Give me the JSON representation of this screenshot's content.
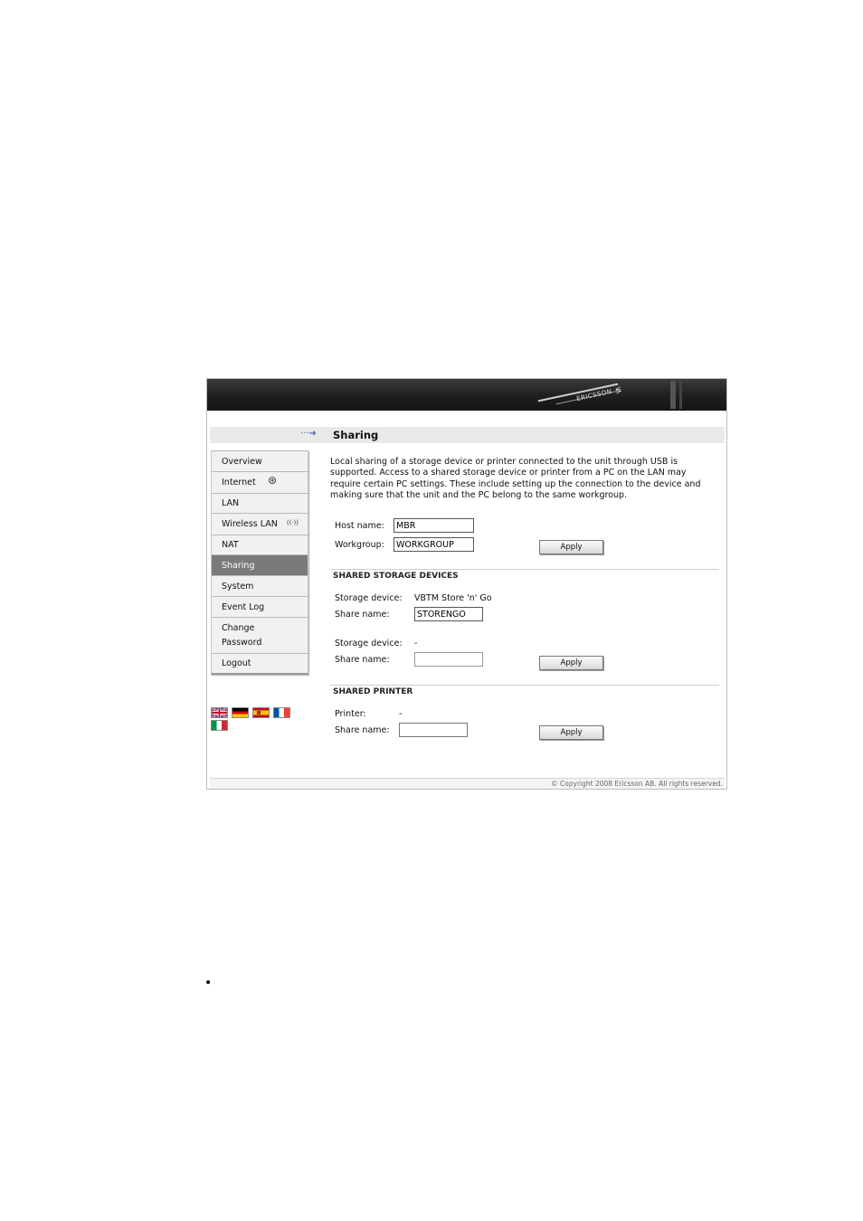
{
  "banner": {
    "logo_text": "ERICSSON",
    "logo_mark": "≶"
  },
  "header": {
    "arrow": "···➜",
    "title": "Sharing"
  },
  "menu": {
    "items": [
      {
        "label": "Overview",
        "icon": ""
      },
      {
        "label": "Internet",
        "icon": "⊛"
      },
      {
        "label": "LAN",
        "icon": ""
      },
      {
        "label": "Wireless LAN",
        "icon": "((·))"
      },
      {
        "label": "NAT",
        "icon": ""
      },
      {
        "label": "Sharing",
        "icon": "",
        "active": true
      },
      {
        "label": "System",
        "icon": ""
      },
      {
        "label": "Event Log",
        "icon": ""
      },
      {
        "label": "Change Password",
        "icon": ""
      },
      {
        "label": "Logout",
        "icon": ""
      }
    ]
  },
  "languages": [
    "english-flag",
    "german-flag",
    "spanish-flag",
    "french-flag",
    "italian-flag"
  ],
  "intro": "Local sharing of a storage device or printer connected to the unit through USB is supported. Access to a shared storage device or printer from a PC on the LAN may require certain PC settings. These include setting up the connection to the device and making sure that the unit and the PC belong to the same workgroup.",
  "general": {
    "host_label": "Host name:",
    "host_value": "MBR",
    "workgroup_label": "Workgroup:",
    "workgroup_value": "WORKGROUP",
    "apply": "Apply"
  },
  "storage": {
    "heading": "SHARED STORAGE DEVICES",
    "device1_label": "Storage device:",
    "device1_value": "VBTM Store 'n' Go",
    "share1_label": "Share name:",
    "share1_value": "STORENGO",
    "device2_label": "Storage device:",
    "device2_value": "-",
    "share2_label": "Share name:",
    "share2_value": "",
    "apply": "Apply"
  },
  "printer": {
    "heading": "SHARED PRINTER",
    "printer_label": "Printer:",
    "printer_value": "-",
    "share_label": "Share name:",
    "share_value": "",
    "apply": "Apply"
  },
  "footer": {
    "copyright": "© Copyright 2008 Ericsson AB. All rights reserved."
  },
  "document": {
    "bullet": "•"
  }
}
